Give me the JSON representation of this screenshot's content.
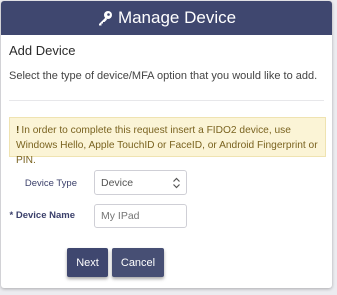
{
  "header": {
    "title": "Manage Device",
    "icon": "key-icon"
  },
  "section": {
    "title": "Add Device",
    "description": "Select the type of device/MFA option that you would like to add."
  },
  "alert": {
    "icon": "!",
    "message": "In order to complete this request insert a FIDO2 device, use Windows Hello, Apple TouchID or FaceID, or Android Fingerprint or PIN."
  },
  "form": {
    "device_type_label": "Device Type",
    "device_type_value": "Device",
    "device_name_label": "* Device Name",
    "device_name_placeholder": "My IPad"
  },
  "buttons": {
    "next": "Next",
    "cancel": "Cancel"
  },
  "colors": {
    "header_bg": "#3f476f",
    "alert_bg": "#fbf4d6",
    "alert_text": "#7a6320"
  }
}
